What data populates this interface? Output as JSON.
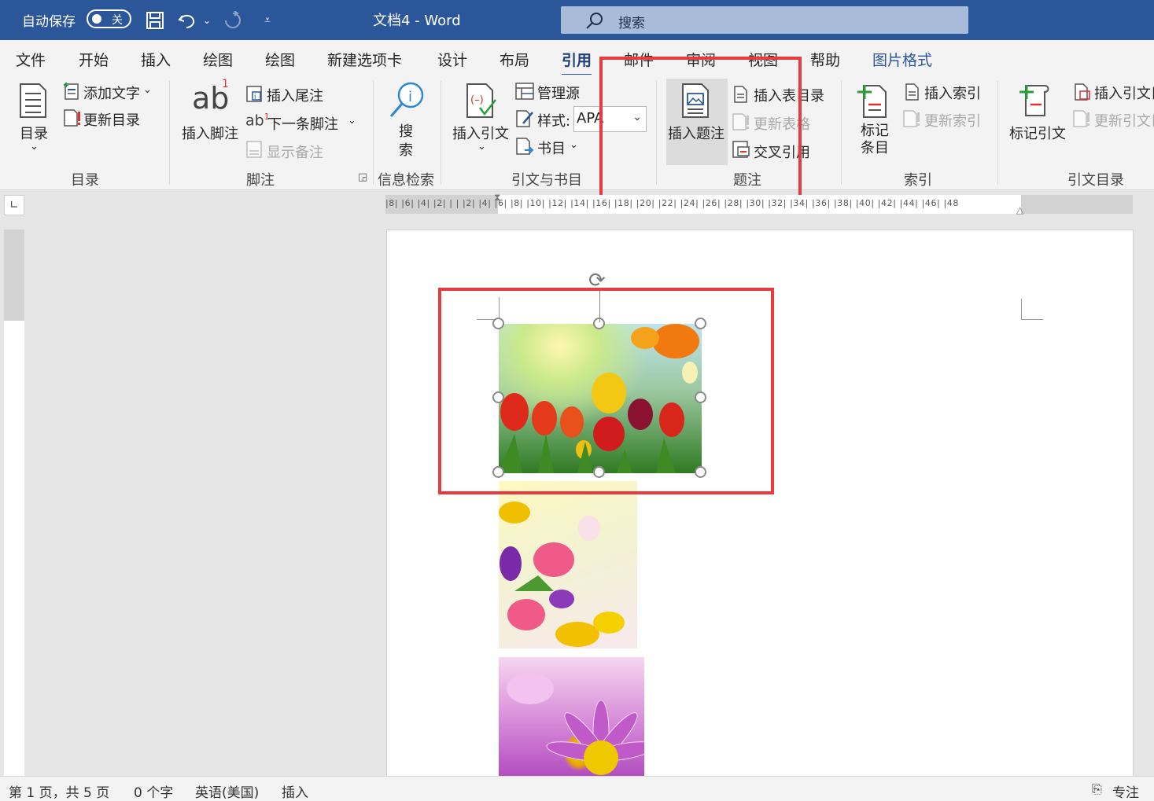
{
  "titlebar": {
    "autosave": "自动保存",
    "toggle_state": "关",
    "title": "文档4  -  Word",
    "search_placeholder": "搜索"
  },
  "tabs": [
    "文件",
    "开始",
    "插入",
    "绘图",
    "绘图",
    "新建选项卡",
    "设计",
    "布局",
    "引用",
    "邮件",
    "审阅",
    "视图",
    "帮助",
    "图片格式"
  ],
  "ribbon": {
    "toc": {
      "button": "目录",
      "add_text": "添加文字",
      "update_toc": "更新目录",
      "group": "目录"
    },
    "footnotes": {
      "insert_footnote": "插入脚注",
      "ab": "ab",
      "insert_endnote": "插入尾注",
      "next_footnote": "下一条脚注",
      "show_notes": "显示备注",
      "group": "脚注"
    },
    "research": {
      "search": "搜\n索",
      "group": "信息检索"
    },
    "citations": {
      "insert_citation": "插入引文",
      "manage_sources": "管理源",
      "style_label": "样式:",
      "style_value": "APA",
      "bibliography": "书目",
      "group": "引文与书目"
    },
    "captions": {
      "insert_caption": "插入题注",
      "insert_table_of_figures": "插入表目录",
      "update_table": "更新表格",
      "cross_reference": "交叉引用",
      "group": "题注"
    },
    "index": {
      "mark_entry": "标记\n条目",
      "insert_index": "插入索引",
      "update_index": "更新索引",
      "group": "索引"
    },
    "authorities": {
      "mark_citation": "标记引文",
      "insert_toa": "插入引文目",
      "update_toa": "更新引文目",
      "group": "引文目录"
    }
  },
  "ruler_ticks": "|8|  |6|  |4|  |2|  |     |  |2|  |4|  |6|  |8|  |10|  |12|  |14|  |16|  |18|  |20|  |22|  |24|  |26|  |28|  |30|  |32|  |34|  |36|  |38|  |40|  |42|  |44|  |46|  |48",
  "status": {
    "page": "第 1 页，共 5 页",
    "words": "0 个字",
    "language": "英语(美国)",
    "mode": "插入",
    "focus": "专注"
  },
  "colors": {
    "title_bar": "#2b579a",
    "highlight": "#e93a40"
  }
}
